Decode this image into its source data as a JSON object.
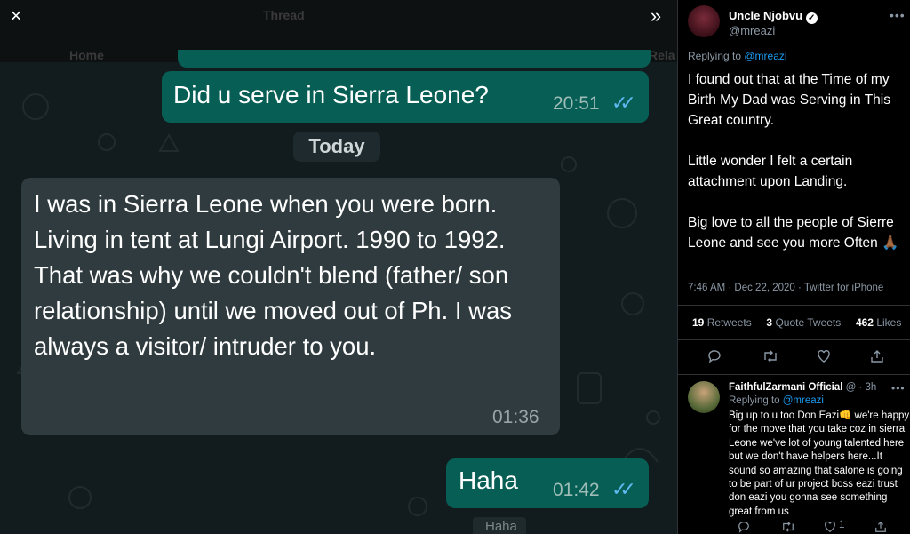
{
  "background_header": {
    "thread_label": "Thread",
    "home_label": "Home",
    "rel_label": "Rela",
    "bottom_peek": "Haha"
  },
  "controls": {
    "close_icon": "close-icon",
    "expand_icon": "chevrons-right-icon",
    "close_glyph": "×",
    "expand_glyph": "»"
  },
  "chat": {
    "messages": [
      {
        "direction": "out",
        "text": "Did u serve in Sierra Leone?",
        "time": "20:51",
        "status": "read"
      },
      {
        "direction": "divider",
        "text": "Today"
      },
      {
        "direction": "in",
        "text": "I was in Sierra Leone when you were born. Living in tent at Lungi Airport. 1990 to 1992.\nThat was why we couldn't blend (father/ son relationship) until we moved out of Ph. I was always a visitor/ intruder to you.",
        "time": "01:36"
      },
      {
        "direction": "out",
        "text": "Haha",
        "time": "01:42",
        "status": "read"
      }
    ],
    "colors": {
      "outgoing": "#065e54",
      "incoming": "#2f3b3e",
      "read_ticks": "#5fb8ef"
    }
  },
  "tweet": {
    "author_name": "Uncle Njobvu",
    "verified": true,
    "handle": "@mreazi",
    "replying_prefix": "Replying to ",
    "replying_to": "@mreazi",
    "body": "I found out that at the Time of my Birth My Dad was Serving in This Great country.\n\nLittle wonder I felt a certain attachment upon Landing.\n\nBig love to all the people of Sierre Leone and see you more Often 🙏🏾",
    "timestamp": "7:46 AM · Dec 22, 2020 · Twitter for iPhone",
    "retweets_count": "19",
    "retweets_label": "Retweets",
    "quotes_count": "3",
    "quotes_label": "Quote Tweets",
    "likes_count": "462",
    "likes_label": "Likes",
    "actions": [
      "reply-icon",
      "retweet-icon",
      "like-icon",
      "share-icon"
    ]
  },
  "reply": {
    "author_name": "FaithfulZarmani Official",
    "meta": "@ · 3h",
    "replying_prefix": "Replying to ",
    "replying_to": "@mreazi",
    "body": "Big up to u too Don Eazi👊 we're happy for the move that you take coz in sierra Leone we've lot of young talented here but we don't have helpers here...It sound so amazing that salone is going to be part of ur project boss eazi trust don eazi you gonna see something great from us",
    "likes_count": "1"
  }
}
